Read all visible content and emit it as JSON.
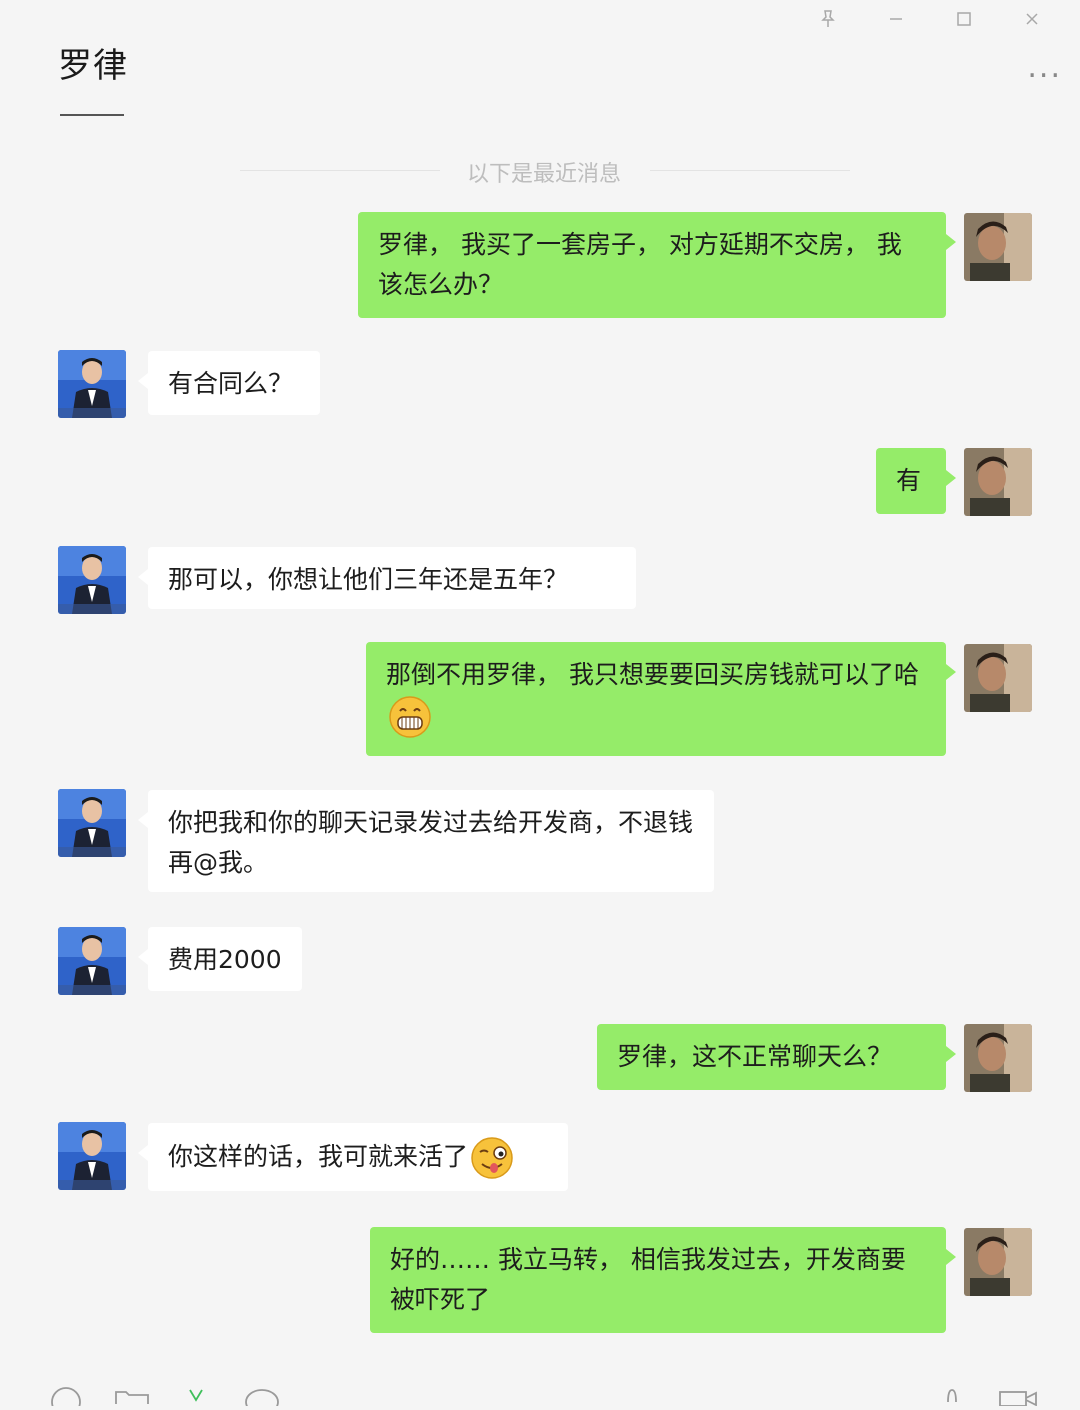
{
  "window": {
    "controls": [
      "pin-icon",
      "minimize-icon",
      "maximize-icon",
      "close-icon"
    ]
  },
  "header": {
    "title": "罗律",
    "more": "..."
  },
  "divider": {
    "text": "以下是最近消息"
  },
  "colors": {
    "outgoing_bubble": "#95ec69",
    "incoming_bubble": "#ffffff",
    "background": "#f5f5f5"
  },
  "messages": [
    {
      "side": "out",
      "text": "罗律， 我买了一套房子， 对方延期不交房， 我该怎么办？"
    },
    {
      "side": "in",
      "text": "有合同么？"
    },
    {
      "side": "out",
      "text": "有"
    },
    {
      "side": "in",
      "text": "那可以，你想让他们三年还是五年？"
    },
    {
      "side": "out",
      "text": "那倒不用罗律， 我只想要要回买房钱就可以了哈",
      "emoji": "grin-emoji"
    },
    {
      "side": "in",
      "text": "你把我和你的聊天记录发过去给开发商，不退钱再@我。"
    },
    {
      "side": "in",
      "text": "费用2000"
    },
    {
      "side": "out",
      "text": "罗律，这不正常聊天么？"
    },
    {
      "side": "in",
      "text": "你这样的话，我可就来活了",
      "emoji": "wink-tongue-emoji"
    },
    {
      "side": "out",
      "text": "好的…… 我立马转， 相信我发过去，开发商要被吓死了"
    }
  ],
  "toolbar": {
    "icons": [
      "emoji-icon",
      "folder-icon",
      "scissors-icon",
      "chat-history-icon",
      "phone-icon",
      "video-icon"
    ]
  }
}
